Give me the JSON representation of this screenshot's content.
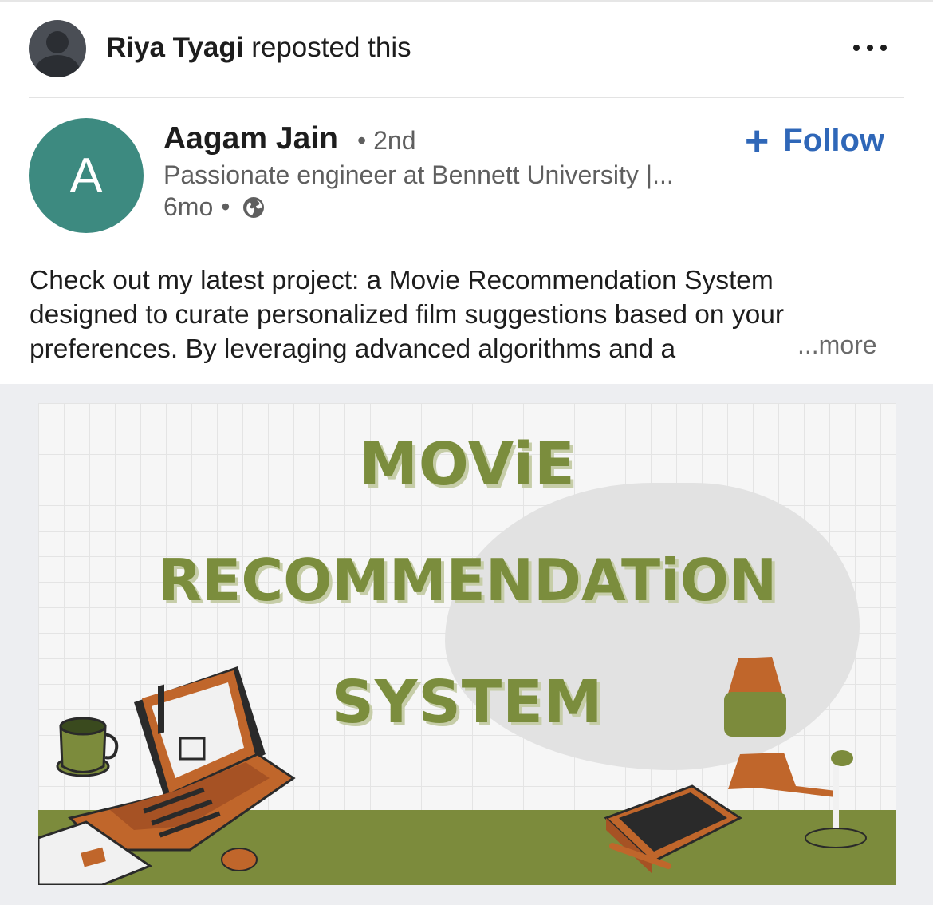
{
  "repost": {
    "name": "Riya Tyagi",
    "action": "reposted this"
  },
  "author": {
    "initial": "A",
    "name": "Aagam Jain",
    "degree": "• 2nd",
    "headline": "Passionate engineer at Bennett University |...",
    "time": "6mo",
    "separator": "•",
    "visibility_icon": "globe-icon"
  },
  "follow": {
    "icon": "plus-icon",
    "label": "Follow"
  },
  "post": {
    "lines": [
      "Check out my latest project: a Movie Recommendation System",
      "designed to curate personalized film suggestions based on your",
      "preferences. By leveraging advanced algorithms and a"
    ],
    "more_label": "...more"
  },
  "media": {
    "title_line_1": "MOViE",
    "title_line_2": "RECOMMENDATiON",
    "title_line_3": "SYSTEM"
  },
  "colors": {
    "follow_blue": "#2f67b8",
    "author_avatar": "#3d8a80",
    "title_green": "#7b8d3d",
    "desk_green": "#7c8b3c",
    "accent_orange": "#c0662b"
  }
}
